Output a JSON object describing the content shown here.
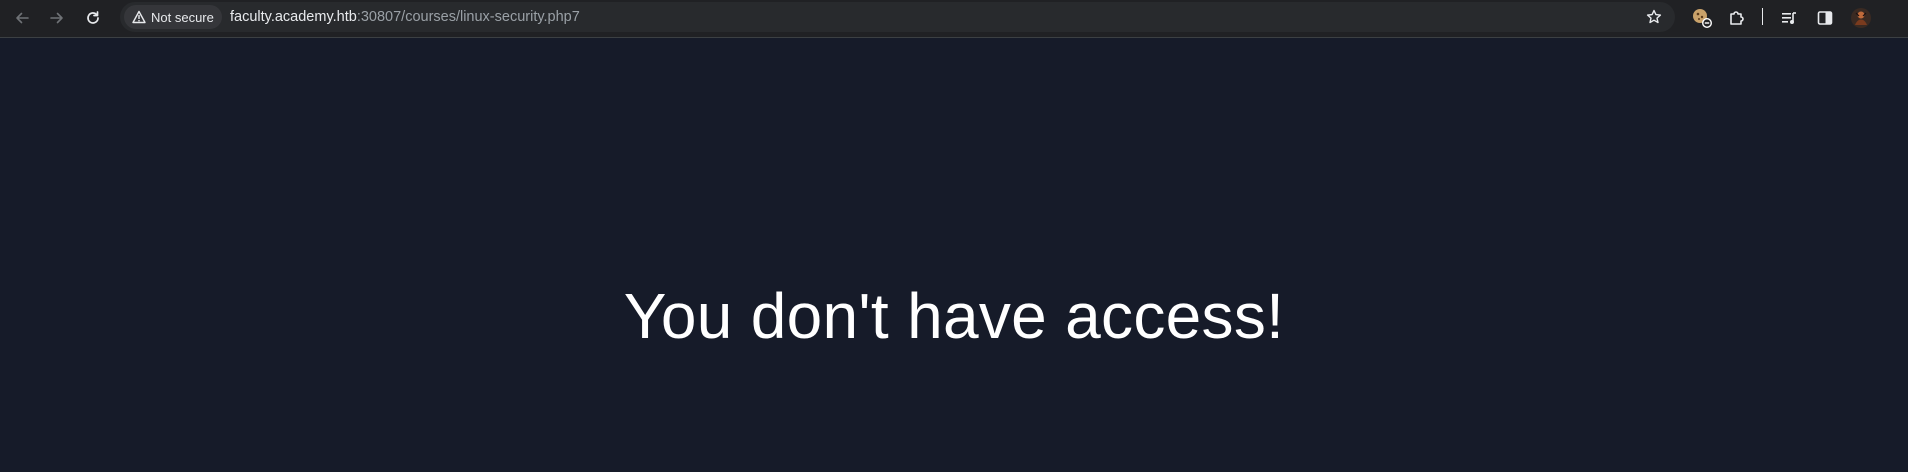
{
  "browser": {
    "security_label": "Not secure",
    "url_host": "faculty.academy.htb",
    "url_path": ":30807/courses/linux-security.php7",
    "icons": [
      "back-icon",
      "forward-icon",
      "reload-icon",
      "warning-icon",
      "star-icon",
      "cookie-extension-icon",
      "extensions-icon",
      "media-controls-icon",
      "side-panel-icon",
      "profile-avatar"
    ]
  },
  "page": {
    "message": "You don't have access!"
  },
  "colors": {
    "page_background": "#161b29",
    "toolbar_background": "#202124",
    "omnibox_background": "#282a2d",
    "text_primary": "#ffffff",
    "url_path": "#9aa0a6"
  }
}
